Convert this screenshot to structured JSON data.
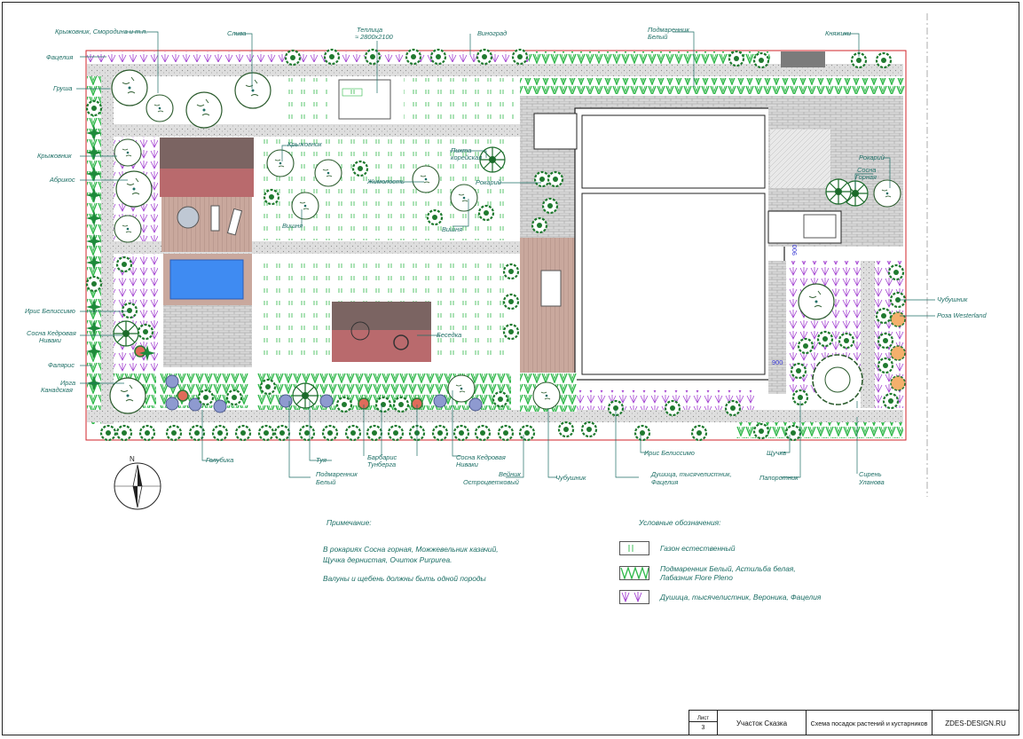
{
  "labels": {
    "fatselia_top": "Фацелия",
    "kryzh_smorod": "Крыжовник, Смородина и т.п.",
    "sliva": "Слива",
    "teplitsa": "Теплица",
    "teplitsa_size": "≈ 2800x2100",
    "vinograd": "Виноград",
    "podmarennik_top_1": "Подмаренник",
    "podmarennik_top_2": "Белый",
    "knyazhiki": "Княжики",
    "grusha": "Груша",
    "kryzhovnik_left": "Крыжовник",
    "abrikos": "Абрикос",
    "kryzhovnik_center": "Крыжовник",
    "pikhta_1": "Пихта",
    "pikhta_2": "корейская",
    "zhimolost": "Жимолость",
    "vishnya_1": "Вишня",
    "vishnya_2": "Вишня",
    "rokariy_center": "Рокарий",
    "rokariy_right": "Рокарий",
    "sosna_gornaya_1": "Сосна",
    "sosna_gornaya_2": "Горная",
    "iris_left": "Ирис Белиссимо",
    "sosna_kedr_left_1": "Сосна Кедровая",
    "sosna_kedr_left_2": "Ниваки",
    "falyaris": "Фалярис",
    "irga_1": "Ирга",
    "irga_2": "Канадская",
    "besedka": "Беседка",
    "chubushnik_right": "Чубушник",
    "roza": "Роза Westerland",
    "golubika": "Голубика",
    "tuya": "Туя",
    "podmarennik_bottom_1": "Подмаренник",
    "podmarennik_bottom_2": "Белый",
    "barbaris_1": "Барбарис",
    "barbaris_2": "Тунберга",
    "sosna_kedr_bottom_1": "Сосна Кедровая",
    "sosna_kedr_bottom_2": "Ниваки",
    "veynik_1": "Вейник",
    "veynik_2": "Остроцветковый",
    "chubushnik_bottom": "Чубушник",
    "iris_bottom": "Ирис Белиссимо",
    "dushitsa_1": "Душица, тысячелистник,",
    "dushitsa_2": "Фацелия",
    "shchuchka": "Щучка",
    "paporotnik": "Папоротник",
    "siren_1": "Сирень",
    "siren_2": "Уланова",
    "dim_900a": "900",
    "dim_900b": "900"
  },
  "notes": {
    "title": "Примечание:",
    "line1": "В рокариях Сосна горная, Можжевельник казачий,",
    "line2": "Щучка дернистая, Очиток Purpurea.",
    "line3": "Валуны и щебень должны быть одной породы"
  },
  "legend": {
    "title": "Условные обозначения:",
    "items": [
      {
        "text": "Газон естественный"
      },
      {
        "text": "Подмаренник Белый, Астильба белая,",
        "text2": "Лабазник Flore Pleno"
      },
      {
        "text": "Душица, тысячелистник, Вероника, Фацелия"
      }
    ]
  },
  "title_block": {
    "sheet_label": "Лист",
    "sheet_number": "3",
    "project": "Участок Сказка",
    "drawing": "Схема посадок растений и кустарников",
    "company": "ZDES-DESIGN.RU"
  },
  "compass": {
    "north": "N"
  },
  "colors": {
    "teal_text": "#1e6f66",
    "grass_green": "#2fb84a",
    "lavender": "#a23fd1",
    "paving": "#d7d7d7",
    "roof_brown": "#7b6462",
    "roof_red": "#b96a6d",
    "pool_blue": "#3f8bf2",
    "deck": "#c9a89d",
    "boundary_red": "#d2232a"
  }
}
